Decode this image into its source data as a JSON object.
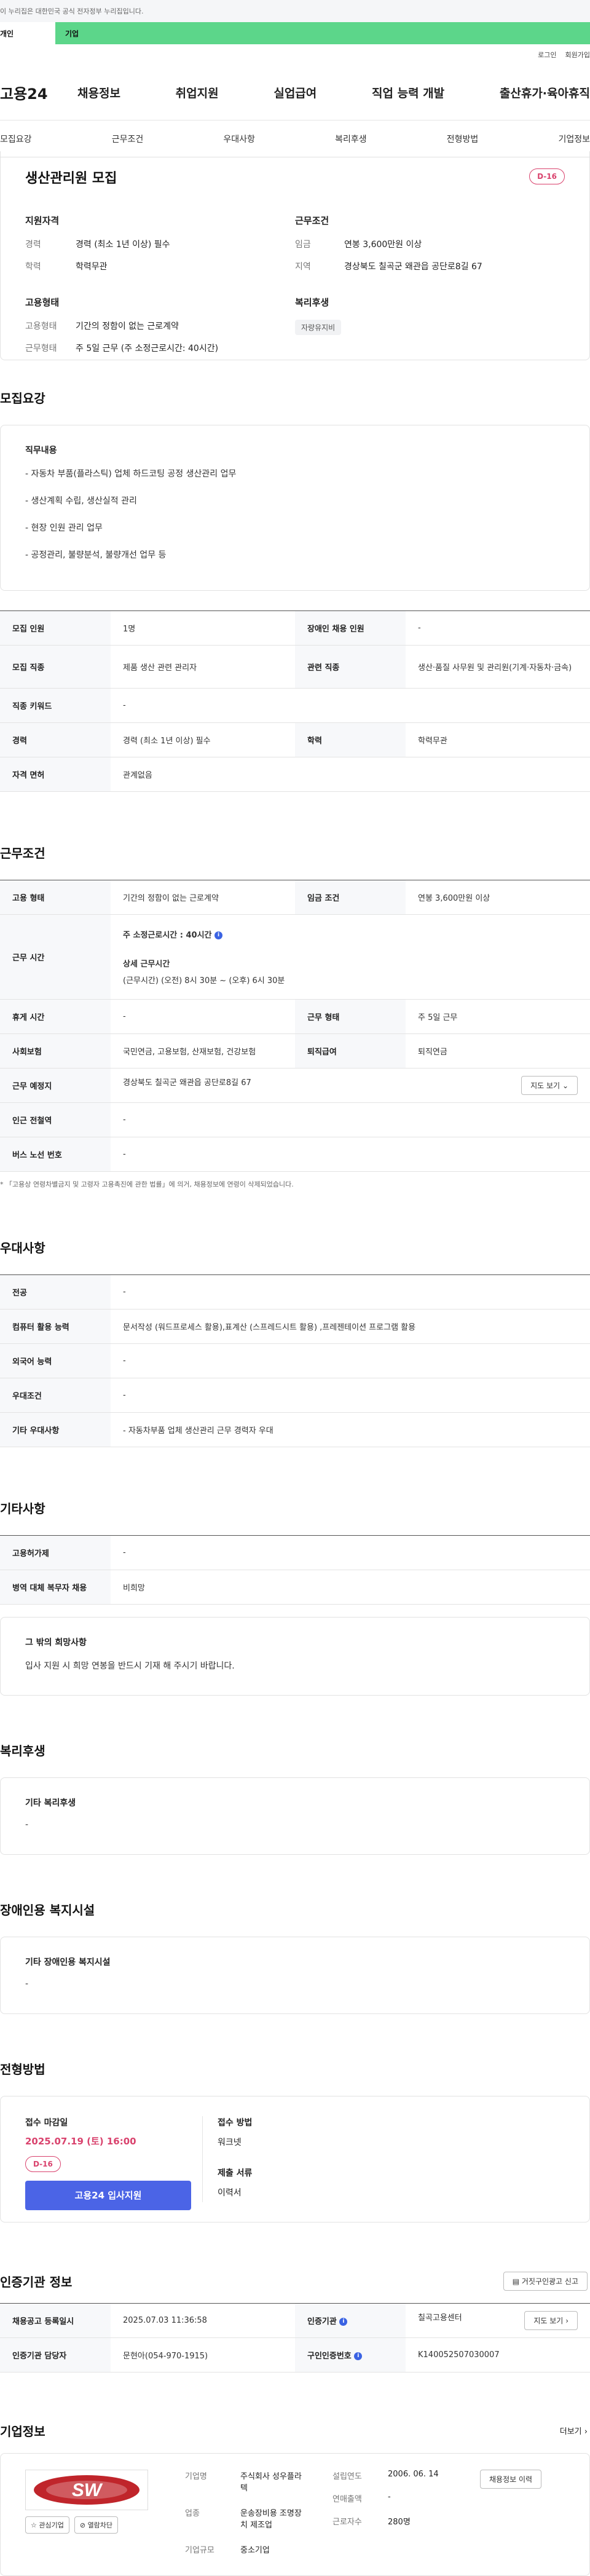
{
  "gov_banner": "이 누리집은 대한민국 공식 전자정부 누리집입니다.",
  "svc_tabs": [
    "개인",
    "기업"
  ],
  "util": [
    "로그인",
    "회원가입"
  ],
  "logo": "고용24",
  "gnb": [
    "채용정보",
    "취업지원",
    "실업급여",
    "직업 능력 개발",
    "출산휴가·육아휴직"
  ],
  "subnav": [
    "모집요강",
    "근무조건",
    "우대사항",
    "복리후생",
    "전형방법",
    "기업정보"
  ],
  "summary": {
    "title": "생산관리원 모집",
    "dday": "D-16",
    "qual_h": "지원자격",
    "qual": [
      {
        "k": "경력",
        "v": "경력 (최소 1년 이상) 필수"
      },
      {
        "k": "학력",
        "v": "학력무관"
      }
    ],
    "work_h": "근무조건",
    "work": [
      {
        "k": "임금",
        "v": "연봉 3,600만원 이상"
      },
      {
        "k": "지역",
        "v": "경상북도 칠곡군 왜관읍 공단로8길 67"
      }
    ],
    "emp_h": "고용형태",
    "emp": [
      {
        "k": "고용형태",
        "v": "기간의 정함이 없는 근로계약"
      },
      {
        "k": "근무형태",
        "v": "주 5일 근무 (주 소정근로시간: 40시간)"
      }
    ],
    "welfare_h": "복리후생",
    "welfare_chip": "자량유지비"
  },
  "recruit": {
    "title": "모집요강",
    "duty_h": "직무내용",
    "duties": [
      "- 자동차 부품(플라스틱) 업체 하드코팅 공정 생산관리 업무",
      "- 생산계획 수립, 생산실적 관리",
      "- 현장 인원 관리 업무",
      "- 공정관리, 불량분석, 불량개선 업무 등"
    ],
    "rows": [
      [
        "모집 인원",
        "1명",
        "장애인 채용 인원",
        "-"
      ],
      [
        "모집 직종",
        "제품 생산 관련 관리자",
        "관련 직종",
        "생산·품질 사무원 및 관리원(기계·자동차·금속)"
      ],
      [
        "직종 키워드",
        "-",
        "",
        ""
      ],
      [
        "경력",
        "경력 (최소 1년 이상) 필수",
        "학력",
        "학력무관"
      ],
      [
        "자격 면허",
        "관계없음",
        "",
        ""
      ]
    ]
  },
  "cond": {
    "title": "근무조건",
    "emp_k": "고용 형태",
    "emp_v": "기간의 정함이 없는 근로계약",
    "wage_k": "임금 조건",
    "wage_v": "연봉 3,600만원 이상",
    "time_k": "근무 시간",
    "time_1": "주 소정근로시간 : 40시간",
    "time_2": "상세 근무시간",
    "time_3": "(근무시간) (오전) 8시 30분 ~ (오후) 6시 30분",
    "rest_k": "휴게 시간",
    "rest_v": "-",
    "type_k": "근무 형태",
    "type_v": "주 5일 근무",
    "ins_k": "사회보험",
    "ins_v": "국민연금, 고용보험, 산재보험, 건강보험",
    "ret_k": "퇴직급여",
    "ret_v": "퇴직연금",
    "loc_k": "근무 예정지",
    "loc_v": "경상북도 칠곡군 왜관읍 공단로8길 67",
    "map_btn": "지도 보기",
    "sub_k": "인근 전철역",
    "sub_v": "-",
    "bus_k": "버스 노선 번호",
    "bus_v": "-",
    "note": "* 「고용상 연령차별금지 및 고령자 고용촉진에 관한 법률」에 의거, 채용정보에 연령이 삭제되었습니다."
  },
  "pref": {
    "title": "우대사항",
    "rows": [
      [
        "전공",
        "-"
      ],
      [
        "컴퓨터 활용 능력",
        "문서작성 (워드프로세스 활용),표계산 (스프레드시트 활용) ,프레젠테이션 프로그램 활용"
      ],
      [
        "외국어 능력",
        "-"
      ],
      [
        "우대조건",
        "-"
      ],
      [
        "기타 우대사항",
        "- 자동차부품 업체 생산관리 근무 경력자 우대"
      ]
    ]
  },
  "etc": {
    "title": "기타사항",
    "rows": [
      [
        "고용허가제",
        "-"
      ],
      [
        "병역 대체 복무자 채용",
        "비희망"
      ]
    ],
    "box_h": "그 밖의 희망사항",
    "box_v": "입사 지원 시 희망 연봉을 반드시 기재 해 주시기 바랍니다."
  },
  "welfare": {
    "title": "복리후생",
    "box_h": "기타 복리후생",
    "box_v": "-"
  },
  "disab": {
    "title": "장애인용 복지시설",
    "box_h": "기타 장애인용 복지시설",
    "box_v": "-"
  },
  "process": {
    "title": "전형방법",
    "deadline_h": "접수 마감일",
    "deadline_v": "2025.07.19 (토) 16:00",
    "dday": "D-16",
    "apply_btn": "고용24 입사지원",
    "method_h": "접수 방법",
    "method_v": "워크넷",
    "docs_h": "제출 서류",
    "docs_v": "이력서"
  },
  "cert": {
    "title": "인증기관 정보",
    "report_btn": "거짓구인광고 신고",
    "rows": [
      [
        "채용공고 등록일시",
        "2025.07.03 11:36:58",
        "인증기관",
        "칠곡고용센터"
      ],
      [
        "인증기관 담당자",
        "문현아(054-970-1915)",
        "구인인증번호",
        "K140052507030007"
      ]
    ],
    "map_btn": "지도 보기"
  },
  "company": {
    "title": "기업정보",
    "more": "더보기",
    "logo_text": "SW",
    "fav_btn": "관심기업",
    "block_btn": "열람차단",
    "name_k": "기업명",
    "name_v": "주식회사 성우플라텍",
    "ind_k": "업종",
    "ind_v": "운송장비용 조명장치 제조업",
    "size_k": "기업규모",
    "size_v": "중소기업",
    "est_k": "설립연도",
    "est_v": "2006. 06. 14",
    "sales_k": "연매출액",
    "sales_v": "-",
    "emp_k": "근로자수",
    "emp_v": "280명",
    "history_btn": "채용정보 이력"
  },
  "colors": {
    "accent_green": "#5cd68a",
    "dday_red": "#d9426d",
    "primary_blue": "#4b64e6"
  }
}
